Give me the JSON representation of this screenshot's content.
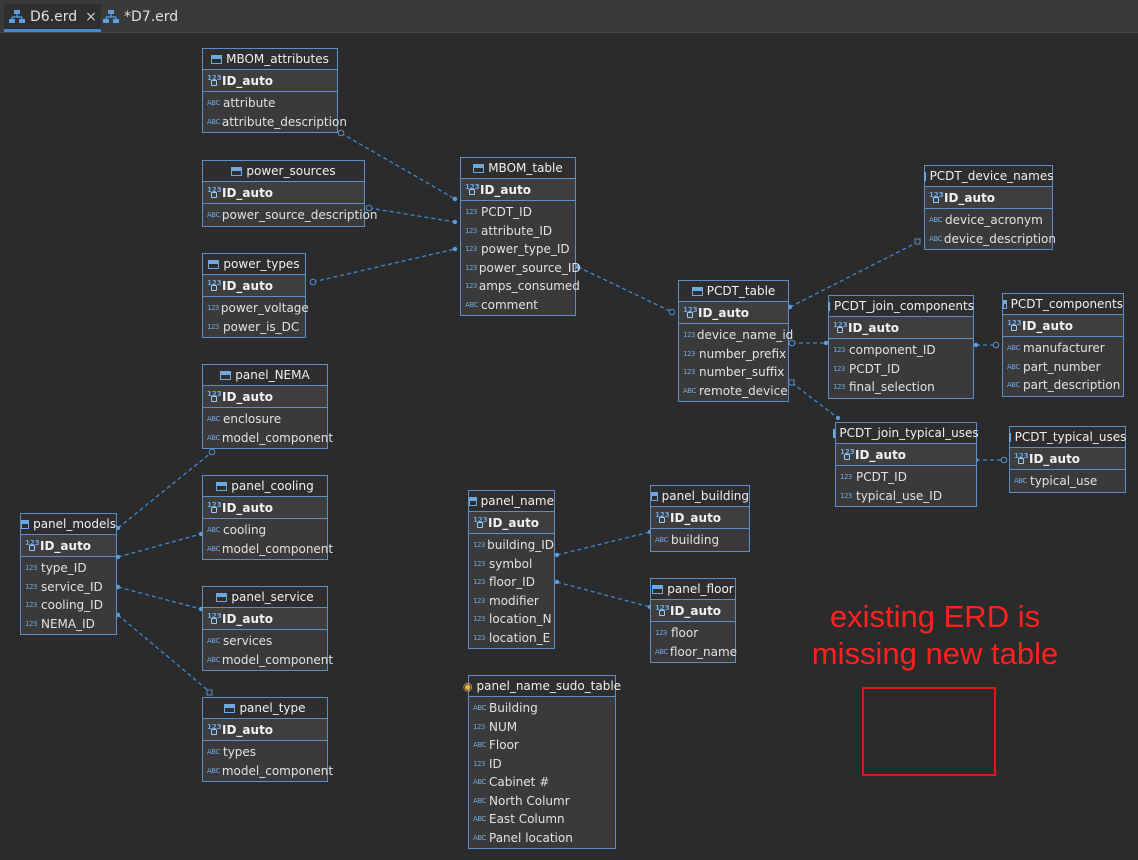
{
  "tabs": [
    {
      "label": "D6.erd",
      "active": true,
      "close": "×"
    },
    {
      "label": "*D7.erd",
      "active": false
    }
  ],
  "colors": {
    "background": "#2b2b2b",
    "entity_border": "#5a8fc8",
    "link": "#3d8ad6",
    "annotation": "#ff2020"
  },
  "entities": {
    "MBOM_attributes": {
      "title": "MBOM_attributes",
      "pk": "ID_auto",
      "cols": [
        [
          "ABC",
          "attribute"
        ],
        [
          "ABC",
          "attribute_description"
        ]
      ]
    },
    "power_sources": {
      "title": "power_sources",
      "pk": "ID_auto",
      "cols": [
        [
          "ABC",
          "power_source_description"
        ]
      ]
    },
    "power_types": {
      "title": "power_types",
      "pk": "ID_auto",
      "cols": [
        [
          "123",
          "power_voltage"
        ],
        [
          "123",
          "power_is_DC"
        ]
      ]
    },
    "MBOM_table": {
      "title": "MBOM_table",
      "pk": "ID_auto",
      "cols": [
        [
          "123",
          "PCDT_ID"
        ],
        [
          "123",
          "attribute_ID"
        ],
        [
          "123",
          "power_type_ID"
        ],
        [
          "123",
          "power_source_ID"
        ],
        [
          "123",
          "amps_consumed"
        ],
        [
          "ABC",
          "comment"
        ]
      ]
    },
    "PCDT_device_names": {
      "title": "PCDT_device_names",
      "pk": "ID_auto",
      "cols": [
        [
          "ABC",
          "device_acronym"
        ],
        [
          "ABC",
          "device_description"
        ]
      ]
    },
    "PCDT_table": {
      "title": "PCDT_table",
      "pk": "ID_auto",
      "cols": [
        [
          "123",
          "device_name_id"
        ],
        [
          "123",
          "number_prefix"
        ],
        [
          "123",
          "number_suffix"
        ],
        [
          "ABC",
          "remote_device"
        ]
      ]
    },
    "PCDT_join_components": {
      "title": "PCDT_join_components",
      "pk": "ID_auto",
      "cols": [
        [
          "123",
          "component_ID"
        ],
        [
          "123",
          "PCDT_ID"
        ],
        [
          "123",
          "final_selection"
        ]
      ]
    },
    "PCDT_components": {
      "title": "PCDT_components",
      "pk": "ID_auto",
      "cols": [
        [
          "ABC",
          "manufacturer"
        ],
        [
          "ABC",
          "part_number"
        ],
        [
          "ABC",
          "part_description"
        ]
      ]
    },
    "PCDT_join_typical_uses": {
      "title": "PCDT_join_typical_uses",
      "pk": "ID_auto",
      "cols": [
        [
          "123",
          "PCDT_ID"
        ],
        [
          "123",
          "typical_use_ID"
        ]
      ]
    },
    "PCDT_typical_uses": {
      "title": "PCDT_typical_uses",
      "pk": "ID_auto",
      "cols": [
        [
          "ABC",
          "typical_use"
        ]
      ]
    },
    "panel_NEMA": {
      "title": "panel_NEMA",
      "pk": "ID_auto",
      "cols": [
        [
          "ABC",
          "enclosure"
        ],
        [
          "ABC",
          "model_component"
        ]
      ]
    },
    "panel_cooling": {
      "title": "panel_cooling",
      "pk": "ID_auto",
      "cols": [
        [
          "ABC",
          "cooling"
        ],
        [
          "ABC",
          "model_component"
        ]
      ]
    },
    "panel_models": {
      "title": "panel_models",
      "pk": "ID_auto",
      "cols": [
        [
          "123",
          "type_ID"
        ],
        [
          "123",
          "service_ID"
        ],
        [
          "123",
          "cooling_ID"
        ],
        [
          "123",
          "NEMA_ID"
        ]
      ]
    },
    "panel_service": {
      "title": "panel_service",
      "pk": "ID_auto",
      "cols": [
        [
          "ABC",
          "services"
        ],
        [
          "ABC",
          "model_component"
        ]
      ]
    },
    "panel_type": {
      "title": "panel_type",
      "pk": "ID_auto",
      "cols": [
        [
          "ABC",
          "types"
        ],
        [
          "ABC",
          "model_component"
        ]
      ]
    },
    "panel_name": {
      "title": "panel_name",
      "pk": "ID_auto",
      "cols": [
        [
          "123",
          "building_ID"
        ],
        [
          "123",
          "symbol"
        ],
        [
          "123",
          "floor_ID"
        ],
        [
          "123",
          "modifier"
        ],
        [
          "123",
          "location_N"
        ],
        [
          "123",
          "location_E"
        ]
      ]
    },
    "panel_building": {
      "title": "panel_building",
      "pk": "ID_auto",
      "cols": [
        [
          "ABC",
          "building"
        ]
      ]
    },
    "panel_floor": {
      "title": "panel_floor",
      "pk": "ID_auto",
      "cols": [
        [
          "123",
          "floor"
        ],
        [
          "ABC",
          "floor_name"
        ]
      ]
    },
    "panel_name_sudo_table": {
      "title": "panel_name_sudo_table",
      "pk": "",
      "cols": [
        [
          "ABC",
          "Building"
        ],
        [
          "123",
          "NUM"
        ],
        [
          "ABC",
          "Floor"
        ],
        [
          "123",
          "ID"
        ],
        [
          "ABC",
          "Cabinet #"
        ],
        [
          "ABC",
          "North Columr"
        ],
        [
          "ABC",
          "East Column"
        ],
        [
          "ABC",
          "Panel location"
        ]
      ]
    }
  },
  "annotation": {
    "line1": "existing ERD is",
    "line2": "missing new table"
  }
}
